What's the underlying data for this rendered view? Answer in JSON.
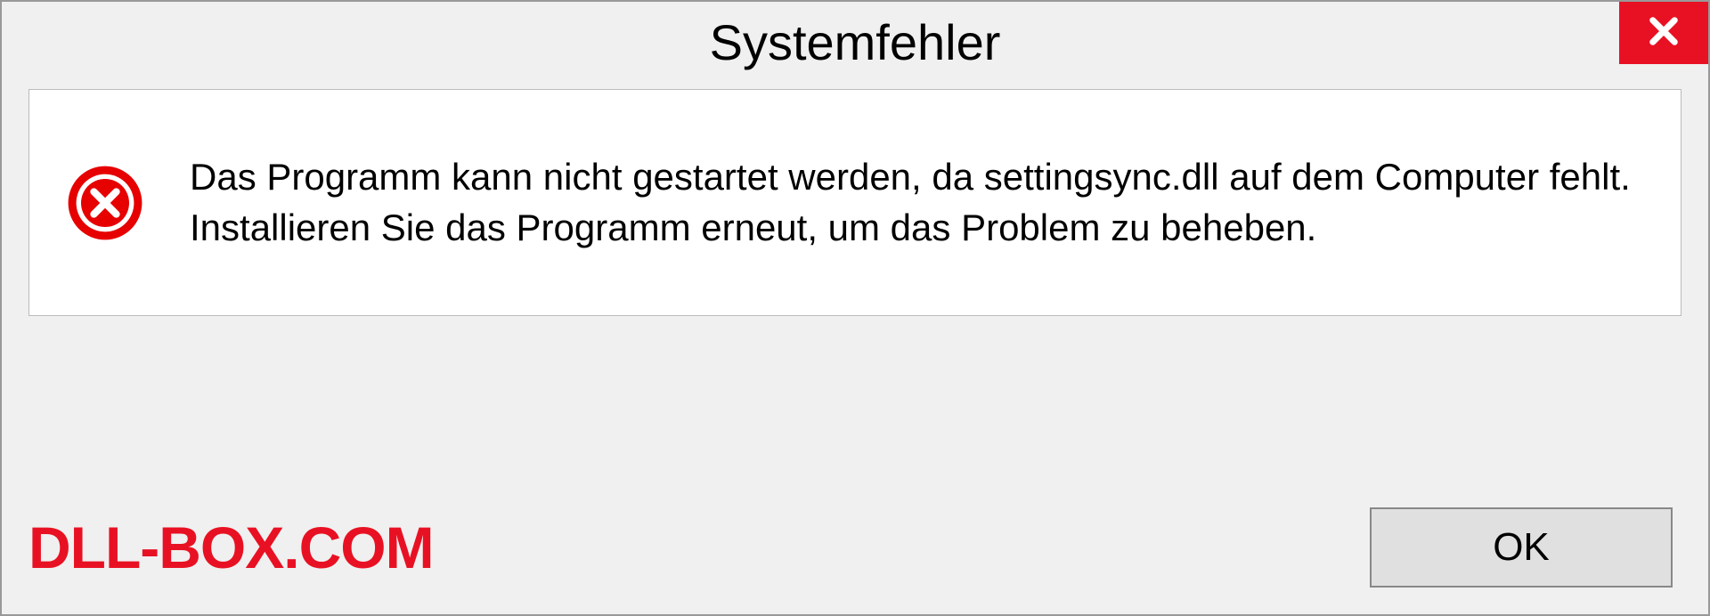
{
  "dialog": {
    "title": "Systemfehler",
    "message": "Das Programm kann nicht gestartet werden, da settingsync.dll auf dem Computer fehlt. Installieren Sie das Programm erneut, um das Problem zu beheben.",
    "ok_label": "OK"
  },
  "watermark": "DLL-BOX.COM",
  "colors": {
    "accent": "#e81123"
  }
}
